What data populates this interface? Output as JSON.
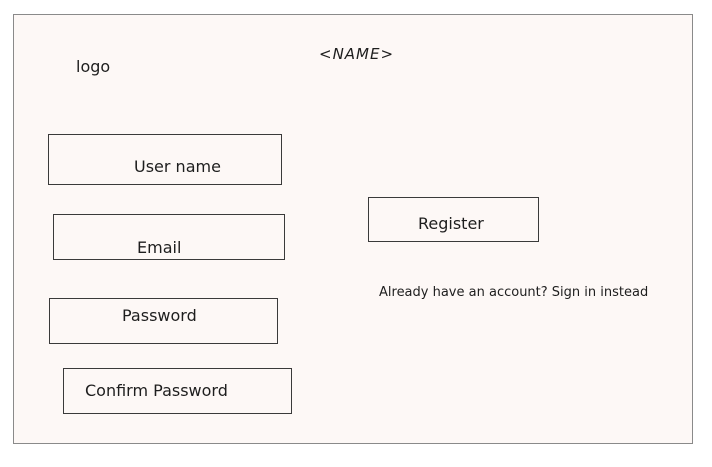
{
  "header": {
    "logo_text": "logo",
    "app_name": "<NAME>"
  },
  "form": {
    "username_placeholder": "User name",
    "email_placeholder": "Email",
    "password_placeholder": "Password",
    "confirm_password_placeholder": "Confirm Password",
    "register_label": "Register",
    "signin_link": "Already have an account? Sign in instead"
  }
}
